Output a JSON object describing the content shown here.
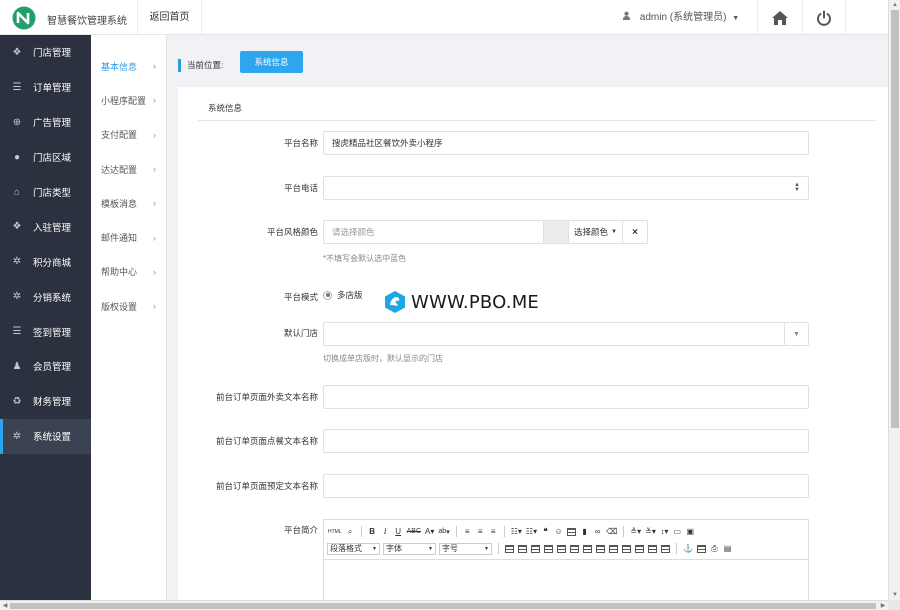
{
  "header": {
    "app_title": "智慧餐饮管理系统",
    "home_link": "返回首页",
    "user": "admin (系统管理员)"
  },
  "sidebar": {
    "items": [
      {
        "label": "门店管理",
        "icon": "cubes-icon"
      },
      {
        "label": "订单管理",
        "icon": "list-icon"
      },
      {
        "label": "广告管理",
        "icon": "globe-icon"
      },
      {
        "label": "门店区域",
        "icon": "map-marker-icon"
      },
      {
        "label": "门店类型",
        "icon": "bank-icon"
      },
      {
        "label": "入驻管理",
        "icon": "cubes-icon"
      },
      {
        "label": "积分商城",
        "icon": "gear-icon"
      },
      {
        "label": "分销系统",
        "icon": "gear-icon"
      },
      {
        "label": "签到管理",
        "icon": "list-icon"
      },
      {
        "label": "会员管理",
        "icon": "user-icon"
      },
      {
        "label": "财务管理",
        "icon": "recycle-icon"
      },
      {
        "label": "系统设置",
        "icon": "gear-icon",
        "active": true
      }
    ]
  },
  "subnav": {
    "items": [
      {
        "label": "基本信息",
        "active": true
      },
      {
        "label": "小程序配置"
      },
      {
        "label": "支付配置"
      },
      {
        "label": "达达配置"
      },
      {
        "label": "模板消息"
      },
      {
        "label": "邮件通知"
      },
      {
        "label": "帮助中心"
      },
      {
        "label": "版权设置"
      }
    ]
  },
  "breadcrumb": {
    "label": "当前位置:",
    "current": "系统信息"
  },
  "panel": {
    "title": "系统信息"
  },
  "form": {
    "platform_name": {
      "label": "平台名称",
      "value": "搜虎精品社区餐饮外卖小程序"
    },
    "platform_phone": {
      "label": "平台电话",
      "value": ""
    },
    "platform_color": {
      "label": "平台风格颜色",
      "placeholder": "请选择颜色",
      "button": "选择颜色",
      "clear": "×",
      "hint": "*不填写会默认选中蓝色"
    },
    "platform_mode": {
      "label": "平台模式",
      "option": "多店版"
    },
    "default_store": {
      "label": "默认门店",
      "value": "",
      "hint": "切换成单店版时，默认显示的门店"
    },
    "takeout_text": {
      "label": "前台订单页面外卖文本名称",
      "value": ""
    },
    "dinein_text": {
      "label": "前台订单页面点餐文本名称",
      "value": ""
    },
    "reserve_text": {
      "label": "前台订单页面预定文本名称",
      "value": ""
    },
    "intro": {
      "label": "平台简介"
    }
  },
  "editor": {
    "toolbar_row1": [
      "HTML",
      "B",
      "I",
      "U",
      "ABC",
      "A",
      "ab"
    ],
    "selects": {
      "paragraph": "段落格式",
      "font": "字体",
      "size": "字号"
    }
  },
  "watermark": {
    "text": "WWW.PBO.ME"
  },
  "colors": {
    "accent": "#2fa5ee",
    "sidebar": "#2b313f"
  }
}
